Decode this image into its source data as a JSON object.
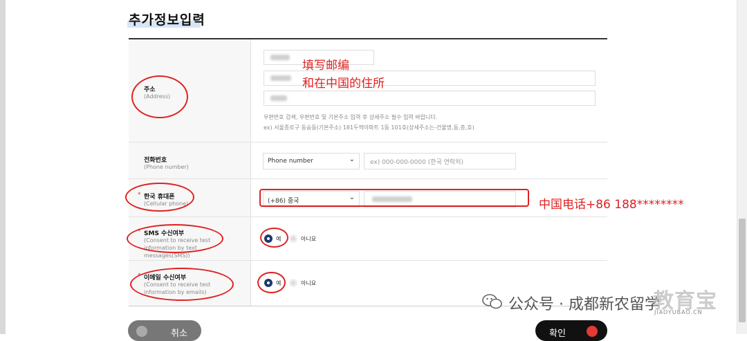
{
  "page": {
    "title": "추가정보입력"
  },
  "address": {
    "label": "주소",
    "sublabel": "(Address)",
    "hint1": "우편번호 검색, 우편번호 및 기본주소 입력 후 상세주소 필수 입력 바랍니다.",
    "hint2": "ex) 서울종로구 동숭동(기본주소) 181두짝아파트 1동 101호(상세주소는-건물명,동,층,호)"
  },
  "phone": {
    "label": "전화번호",
    "sublabel": "(Phone number)",
    "select_value": "Phone number",
    "placeholder": "ex) 000-000-0000 (한국 연락처)"
  },
  "mobile": {
    "required_mark": "*",
    "label": "한국 휴대폰",
    "sublabel": "(Cellular phone)",
    "select_value": "(+86) 중국"
  },
  "sms": {
    "required_mark": "*",
    "label": "SMS 수신여부",
    "sublabel": "(Consent to receive test information by text messages(SMS))",
    "yes": "예",
    "no": "아니요",
    "selected": "yes"
  },
  "email": {
    "required_mark": "*",
    "label": "이메일 수신여부",
    "sublabel": "(Consent to receive test information by emails)",
    "yes": "예",
    "no": "아니요",
    "selected": "yes"
  },
  "annotations": {
    "postcode_note_1": "填写邮编",
    "postcode_note_2": "和在中国的住所",
    "phone_note": "中国电话+86  188********"
  },
  "buttons": {
    "cancel": "취소",
    "confirm": "확인"
  },
  "watermark": {
    "text": "公众号 · 成都新农留学",
    "brand": "教育宝",
    "url": "JIAOYUBAO.CN"
  },
  "colors": {
    "annotation_red": "#e02020",
    "radio_selected": "#1e3a6e",
    "confirm_button": "#111111",
    "cancel_button": "#777777"
  }
}
